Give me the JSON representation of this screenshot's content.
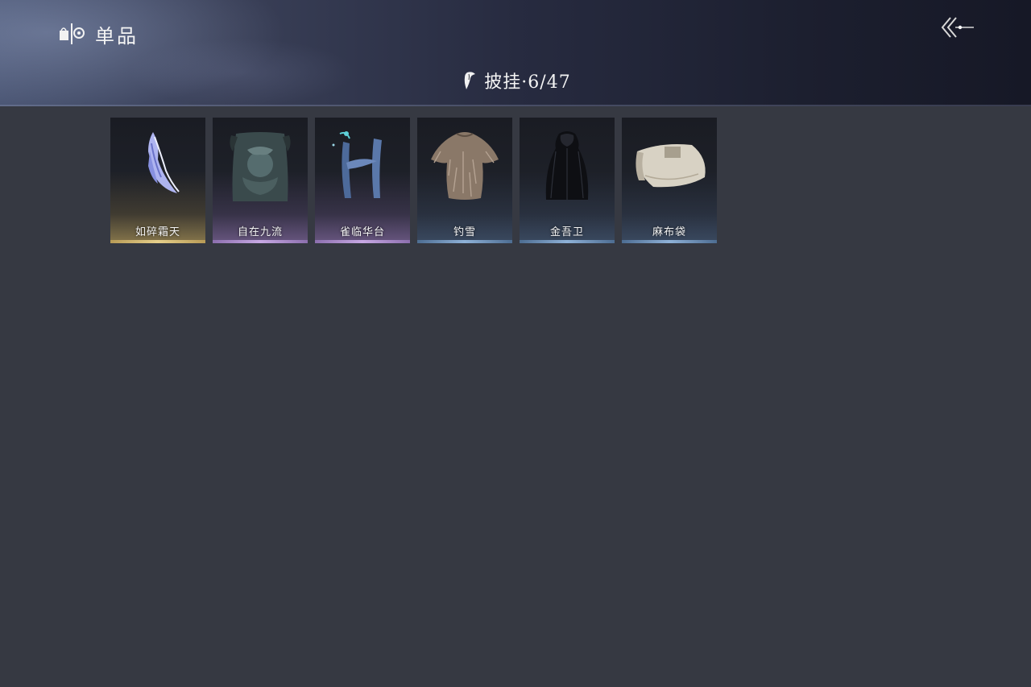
{
  "header": {
    "title": "单品",
    "title_icon": "wardrobe-icon",
    "back_icon": "back-arrow-icon"
  },
  "category": {
    "label": "披挂·6/47",
    "icon": "cape-icon"
  },
  "items": [
    {
      "name": "如碎霜天",
      "rarity": "gold",
      "rarity_color": "#d9be77"
    },
    {
      "name": "自在九流",
      "rarity": "purple",
      "rarity_color": "#b28fd4"
    },
    {
      "name": "雀临华台",
      "rarity": "purple",
      "rarity_color": "#b28fd4"
    },
    {
      "name": "钓雪",
      "rarity": "blue",
      "rarity_color": "#7b9cc4"
    },
    {
      "name": "金吾卫",
      "rarity": "blue",
      "rarity_color": "#7b9cc4"
    },
    {
      "name": "麻布袋",
      "rarity": "blue",
      "rarity_color": "#7b9cc4"
    }
  ],
  "colors": {
    "background": "#363942",
    "header_dark": "#161826",
    "header_light": "#4a5573"
  }
}
